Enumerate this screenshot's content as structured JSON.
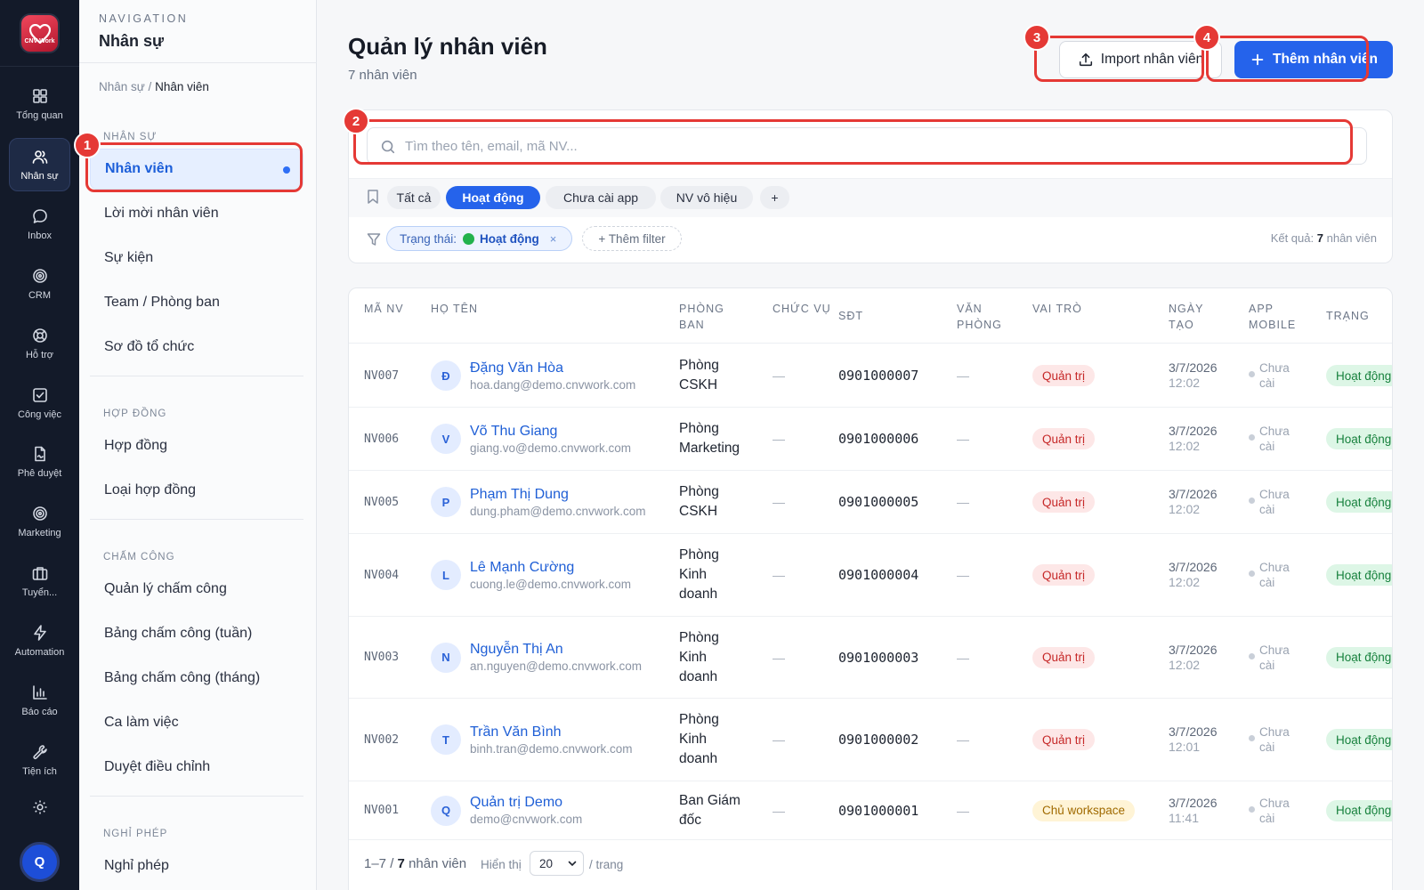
{
  "rail": {
    "items": [
      {
        "label": "Tổng quan",
        "icon": "grid-icon"
      },
      {
        "label": "Nhân sự",
        "icon": "users-icon"
      },
      {
        "label": "Inbox",
        "icon": "chat-icon"
      },
      {
        "label": "CRM",
        "icon": "target-icon"
      },
      {
        "label": "Hỗ trợ",
        "icon": "lifebuoy-icon"
      },
      {
        "label": "Công việc",
        "icon": "checkbox-icon"
      },
      {
        "label": "Phê duyệt",
        "icon": "document-sign-icon"
      },
      {
        "label": "Marketing",
        "icon": "target-icon"
      },
      {
        "label": "Tuyển...",
        "icon": "briefcase-icon"
      },
      {
        "label": "Automation",
        "icon": "lightning-icon"
      },
      {
        "label": "Báo cáo",
        "icon": "bar-chart-icon"
      },
      {
        "label": "Tiện ích",
        "icon": "wrench-icon"
      }
    ],
    "logo_text": "CNV Work",
    "avatar_initial": "Q"
  },
  "sidebar": {
    "kicker": "NAVIGATION",
    "title": "Nhân sự",
    "breadcrumb_parent": "Nhân sự /",
    "breadcrumb_current": "Nhân viên",
    "groups": [
      {
        "label": "NHÂN SỰ",
        "items": [
          "Nhân viên",
          "Lời mời nhân viên",
          "Sự kiện",
          "Team / Phòng ban",
          "Sơ đồ tổ chức"
        ]
      },
      {
        "label": "HỢP ĐỒNG",
        "items": [
          "Hợp đồng",
          "Loại hợp đồng"
        ]
      },
      {
        "label": "CHẤM CÔNG",
        "items": [
          "Quản lý chấm công",
          "Bảng chấm công (tuần)",
          "Bảng chấm công (tháng)",
          "Ca làm việc",
          "Duyệt điều chỉnh"
        ]
      },
      {
        "label": "NGHỈ PHÉP",
        "items": [
          "Nghỉ phép"
        ]
      }
    ]
  },
  "header": {
    "title": "Quản lý nhân viên",
    "subtitle": "7 nhân viên",
    "import_label": "Import nhân viên",
    "add_label": "Thêm nhân viên"
  },
  "search": {
    "placeholder": "Tìm theo tên, email, mã NV...",
    "value": ""
  },
  "segments": [
    "Tất cả",
    "Hoạt động",
    "Chưa cài app",
    "NV vô hiệu",
    "+"
  ],
  "active_segment": "Hoạt động",
  "filter": {
    "chip_key": "Trạng thái:",
    "chip_value": "Hoạt động",
    "chip_remove": "×",
    "add_label": "+ Thêm filter",
    "result_prefix": "Kết quả:",
    "result_count": "7",
    "result_suffix": "nhân viên"
  },
  "table": {
    "headers": [
      "MÃ NV",
      "HỌ TÊN",
      "PHÒNG BAN",
      "CHỨC VỤ",
      "SĐT",
      "VĂN PHÒNG",
      "VAI TRÒ",
      "NGÀY TẠO",
      "APP MOBILE",
      "TRẠNG"
    ],
    "rows": [
      {
        "code": "NV007",
        "initial": "Đ",
        "name": "Đặng Văn Hòa",
        "email": "hoa.dang@demo.cnvwork.com",
        "dept": [
          "Phòng",
          "CSKH"
        ],
        "title": "—",
        "phone": "0901000007",
        "office": "—",
        "role": "Quản trị",
        "date": "3/7/2026",
        "time": "12:02",
        "app": [
          "Chưa",
          "cài"
        ],
        "status": "Hoạt động"
      },
      {
        "code": "NV006",
        "initial": "V",
        "name": "Võ Thu Giang",
        "email": "giang.vo@demo.cnvwork.com",
        "dept": [
          "Phòng",
          "Marketing"
        ],
        "title": "—",
        "phone": "0901000006",
        "office": "—",
        "role": "Quản trị",
        "date": "3/7/2026",
        "time": "12:02",
        "app": [
          "Chưa",
          "cài"
        ],
        "status": "Hoạt động"
      },
      {
        "code": "NV005",
        "initial": "P",
        "name": "Phạm Thị Dung",
        "email": "dung.pham@demo.cnvwork.com",
        "dept": [
          "Phòng",
          "CSKH"
        ],
        "title": "—",
        "phone": "0901000005",
        "office": "—",
        "role": "Quản trị",
        "date": "3/7/2026",
        "time": "12:02",
        "app": [
          "Chưa",
          "cài"
        ],
        "status": "Hoạt động"
      },
      {
        "code": "NV004",
        "initial": "L",
        "name": "Lê Mạnh Cường",
        "email": "cuong.le@demo.cnvwork.com",
        "dept": [
          "Phòng",
          "Kinh",
          "doanh"
        ],
        "title": "—",
        "phone": "0901000004",
        "office": "—",
        "role": "Quản trị",
        "date": "3/7/2026",
        "time": "12:02",
        "app": [
          "Chưa",
          "cài"
        ],
        "status": "Hoạt động"
      },
      {
        "code": "NV003",
        "initial": "N",
        "name": "Nguyễn Thị An",
        "email": "an.nguyen@demo.cnvwork.com",
        "dept": [
          "Phòng",
          "Kinh",
          "doanh"
        ],
        "title": "—",
        "phone": "0901000003",
        "office": "—",
        "role": "Quản trị",
        "date": "3/7/2026",
        "time": "12:02",
        "app": [
          "Chưa",
          "cài"
        ],
        "status": "Hoạt động"
      },
      {
        "code": "NV002",
        "initial": "T",
        "name": "Trần Văn Bình",
        "email": "binh.tran@demo.cnvwork.com",
        "dept": [
          "Phòng",
          "Kinh",
          "doanh"
        ],
        "title": "—",
        "phone": "0901000002",
        "office": "—",
        "role": "Quản trị",
        "date": "3/7/2026",
        "time": "12:01",
        "app": [
          "Chưa",
          "cài"
        ],
        "status": "Hoạt động"
      },
      {
        "code": "NV001",
        "initial": "Q",
        "name": "Quản trị Demo",
        "email": "demo@cnvwork.com",
        "dept": [
          "Ban Giám",
          "đốc"
        ],
        "title": "—",
        "phone": "0901000001",
        "office": "—",
        "role": "Chủ workspace",
        "date": "3/7/2026",
        "time": "11:41",
        "app": [
          "Chưa",
          "cài"
        ],
        "status": "Hoạt động"
      }
    ]
  },
  "pagination": {
    "range": "1–7 /",
    "total": "7",
    "unit": "nhân viên",
    "per_label": "Hiển thị",
    "per_value": "20",
    "per_unit": "/ trang"
  },
  "callouts": [
    "1",
    "2",
    "3",
    "4"
  ],
  "colors": {
    "accent": "#2563eb",
    "callout": "#e53935",
    "rail_bg": "#131a29"
  }
}
